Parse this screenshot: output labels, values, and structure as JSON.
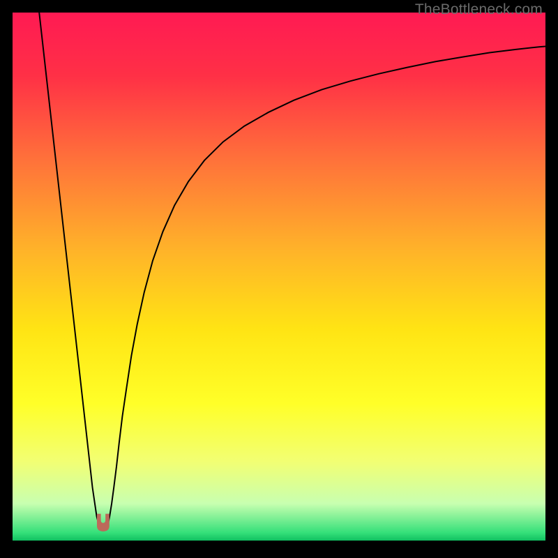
{
  "watermark": "TheBottleneck.com",
  "chart_data": {
    "type": "line",
    "title": "",
    "xlabel": "",
    "ylabel": "",
    "xlim": [
      0,
      100
    ],
    "ylim": [
      0,
      100
    ],
    "background_gradient": {
      "stops": [
        {
          "pos": 0.0,
          "color": "#ff1a53"
        },
        {
          "pos": 0.12,
          "color": "#ff3046"
        },
        {
          "pos": 0.28,
          "color": "#ff723a"
        },
        {
          "pos": 0.45,
          "color": "#ffb329"
        },
        {
          "pos": 0.6,
          "color": "#ffe414"
        },
        {
          "pos": 0.74,
          "color": "#ffff28"
        },
        {
          "pos": 0.85,
          "color": "#f2ff73"
        },
        {
          "pos": 0.93,
          "color": "#c8ffb0"
        },
        {
          "pos": 0.985,
          "color": "#35e07a"
        },
        {
          "pos": 1.0,
          "color": "#10c060"
        }
      ]
    },
    "series": [
      {
        "name": "bottleneck-curve",
        "color": "#000000",
        "width": 2.0,
        "x": [
          5.0,
          6,
          7,
          8,
          9,
          10,
          11,
          12,
          13,
          14,
          15,
          15.8,
          16.3,
          16.8,
          17.3,
          17.8,
          18.2,
          18.6,
          19.0,
          19.5,
          20.0,
          20.6,
          21.4,
          22.3,
          23.4,
          24.7,
          26.3,
          28.2,
          30.4,
          33.0,
          36.0,
          39.5,
          43.5,
          48.0,
          52.8,
          58.0,
          63.3,
          68.7,
          74.0,
          79.3,
          84.5,
          89.5,
          94.3,
          98.8,
          100.0
        ],
        "values": [
          100,
          91,
          82,
          73,
          64,
          55,
          46,
          37,
          28,
          19,
          10,
          4.5,
          2.6,
          2.0,
          2.0,
          2.6,
          4.5,
          7.0,
          10.0,
          14.0,
          18.5,
          23.5,
          29.0,
          35.0,
          41.0,
          47.0,
          53.0,
          58.5,
          63.5,
          68.0,
          72.0,
          75.5,
          78.5,
          81.1,
          83.4,
          85.4,
          87.0,
          88.4,
          89.6,
          90.7,
          91.6,
          92.4,
          93.0,
          93.5,
          93.6
        ]
      }
    ],
    "marker": {
      "name": "minimum-marker",
      "shape": "u-notch",
      "color": "#bb6a5a",
      "x": 17.0,
      "y": 2.0,
      "width_x": 2.2,
      "height_y": 3.0
    }
  }
}
